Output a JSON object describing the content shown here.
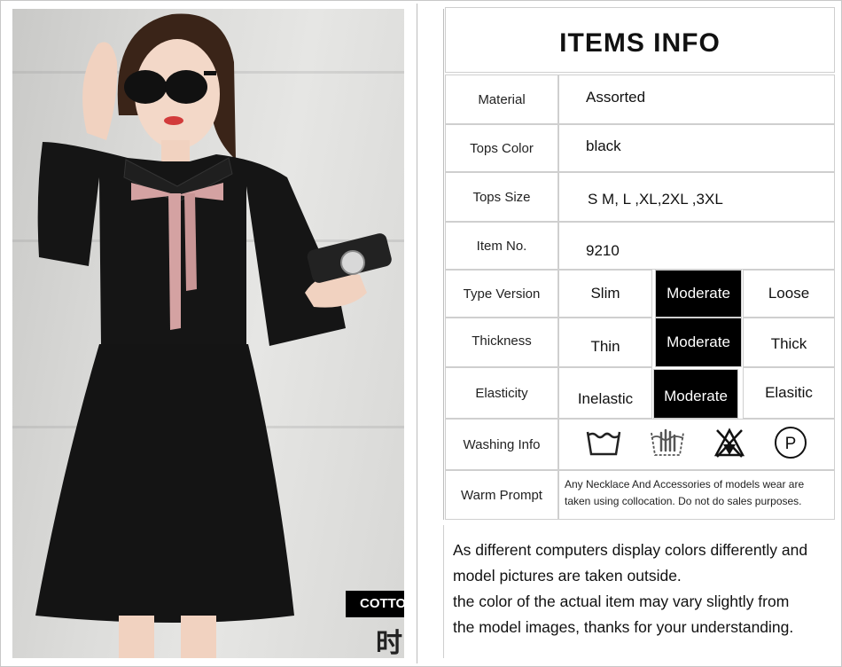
{
  "photo": {
    "tag_text": "COTTON",
    "glyph_text": "时"
  },
  "table": {
    "title": "ITEMS INFO",
    "rows": [
      {
        "label": "Material",
        "value": "Assorted"
      },
      {
        "label": "Tops Color",
        "value": "black"
      },
      {
        "label": "Tops Size",
        "value": "S M, L ,XL,2XL ,3XL"
      },
      {
        "label": "Item No.",
        "value": "9210"
      }
    ],
    "scales": [
      {
        "label": "Type Version",
        "options": [
          "Slim",
          "Moderate",
          "Loose"
        ],
        "selected": "Moderate"
      },
      {
        "label": "Thickness",
        "options": [
          "Thin",
          "Moderate",
          "Thick"
        ],
        "selected": "Moderate"
      },
      {
        "label": "Elasticity",
        "options": [
          "Inelastic",
          "Moderate",
          "Elasitic"
        ],
        "selected": "Moderate"
      }
    ],
    "washing": {
      "label": "Washing Info",
      "icons": [
        "wash-tub-icon",
        "hand-wash-icon",
        "do-not-bleach-icon",
        "dry-clean-p-icon"
      ],
      "dry_clean_letter": "P"
    },
    "prompt": {
      "label": "Warm Prompt",
      "text": "Any Necklace And Accessories of models wear are taken using collocation. Do not do sales purposes."
    }
  },
  "notice": {
    "lines": [
      "As different computers display colors differently and",
      "model pictures are taken outside.",
      "the color of the actual item may vary slightly from",
      "the model images, thanks for your understanding."
    ]
  },
  "colors": {
    "selected_bg": "#000000",
    "bow": "#d4a2a2",
    "dress": "#141414",
    "border": "#cfcfcf"
  }
}
